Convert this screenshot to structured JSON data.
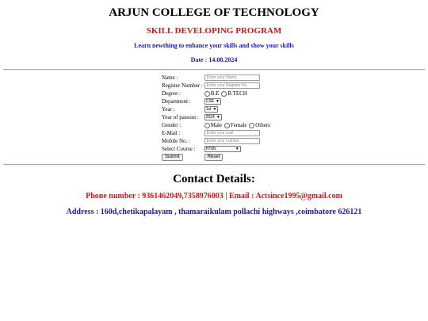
{
  "header": {
    "college": "ARJUN COLLEGE OF TECHNOLOGY",
    "program": "SKILL DEVELOPING PROGRAM",
    "tagline": "Learn newthing to enhance your skills and show your skills",
    "date": "Date : 14.08.2024"
  },
  "form": {
    "name": {
      "label": "Name :",
      "placeholder": "Enter your Name"
    },
    "register": {
      "label": "Register Number :",
      "placeholder": "Enter your Register No"
    },
    "degree": {
      "label": "Degree :",
      "options": [
        "B.E",
        "B.TECH"
      ]
    },
    "department": {
      "label": "Department :",
      "value": "CSE"
    },
    "year": {
      "label": "Year :",
      "value": "1st"
    },
    "passout": {
      "label": "Year of passout :",
      "value": "2024"
    },
    "gender": {
      "label": "Gender :",
      "options": [
        "Male",
        "Female",
        "Others"
      ]
    },
    "email": {
      "label": "E-Mail :",
      "placeholder": "Enter your mail"
    },
    "mobile": {
      "label": "Mobile No. :",
      "placeholder": "Enter your number"
    },
    "course": {
      "label": "Select Course :",
      "value": "HTML"
    },
    "submit_label": "Submit",
    "reset_label": "Reset"
  },
  "contact": {
    "title": "Contact Details:",
    "phone_email": "Phone number : 9361462049,7358976003 | Email : Actsince1995@gmail.com",
    "address": "Address : 160d,chetikapalayam , thamaraikulam pollachi highways ,coimbatore 626121"
  },
  "colors": {
    "red": "#e01010",
    "blue": "#1a1ab0"
  }
}
